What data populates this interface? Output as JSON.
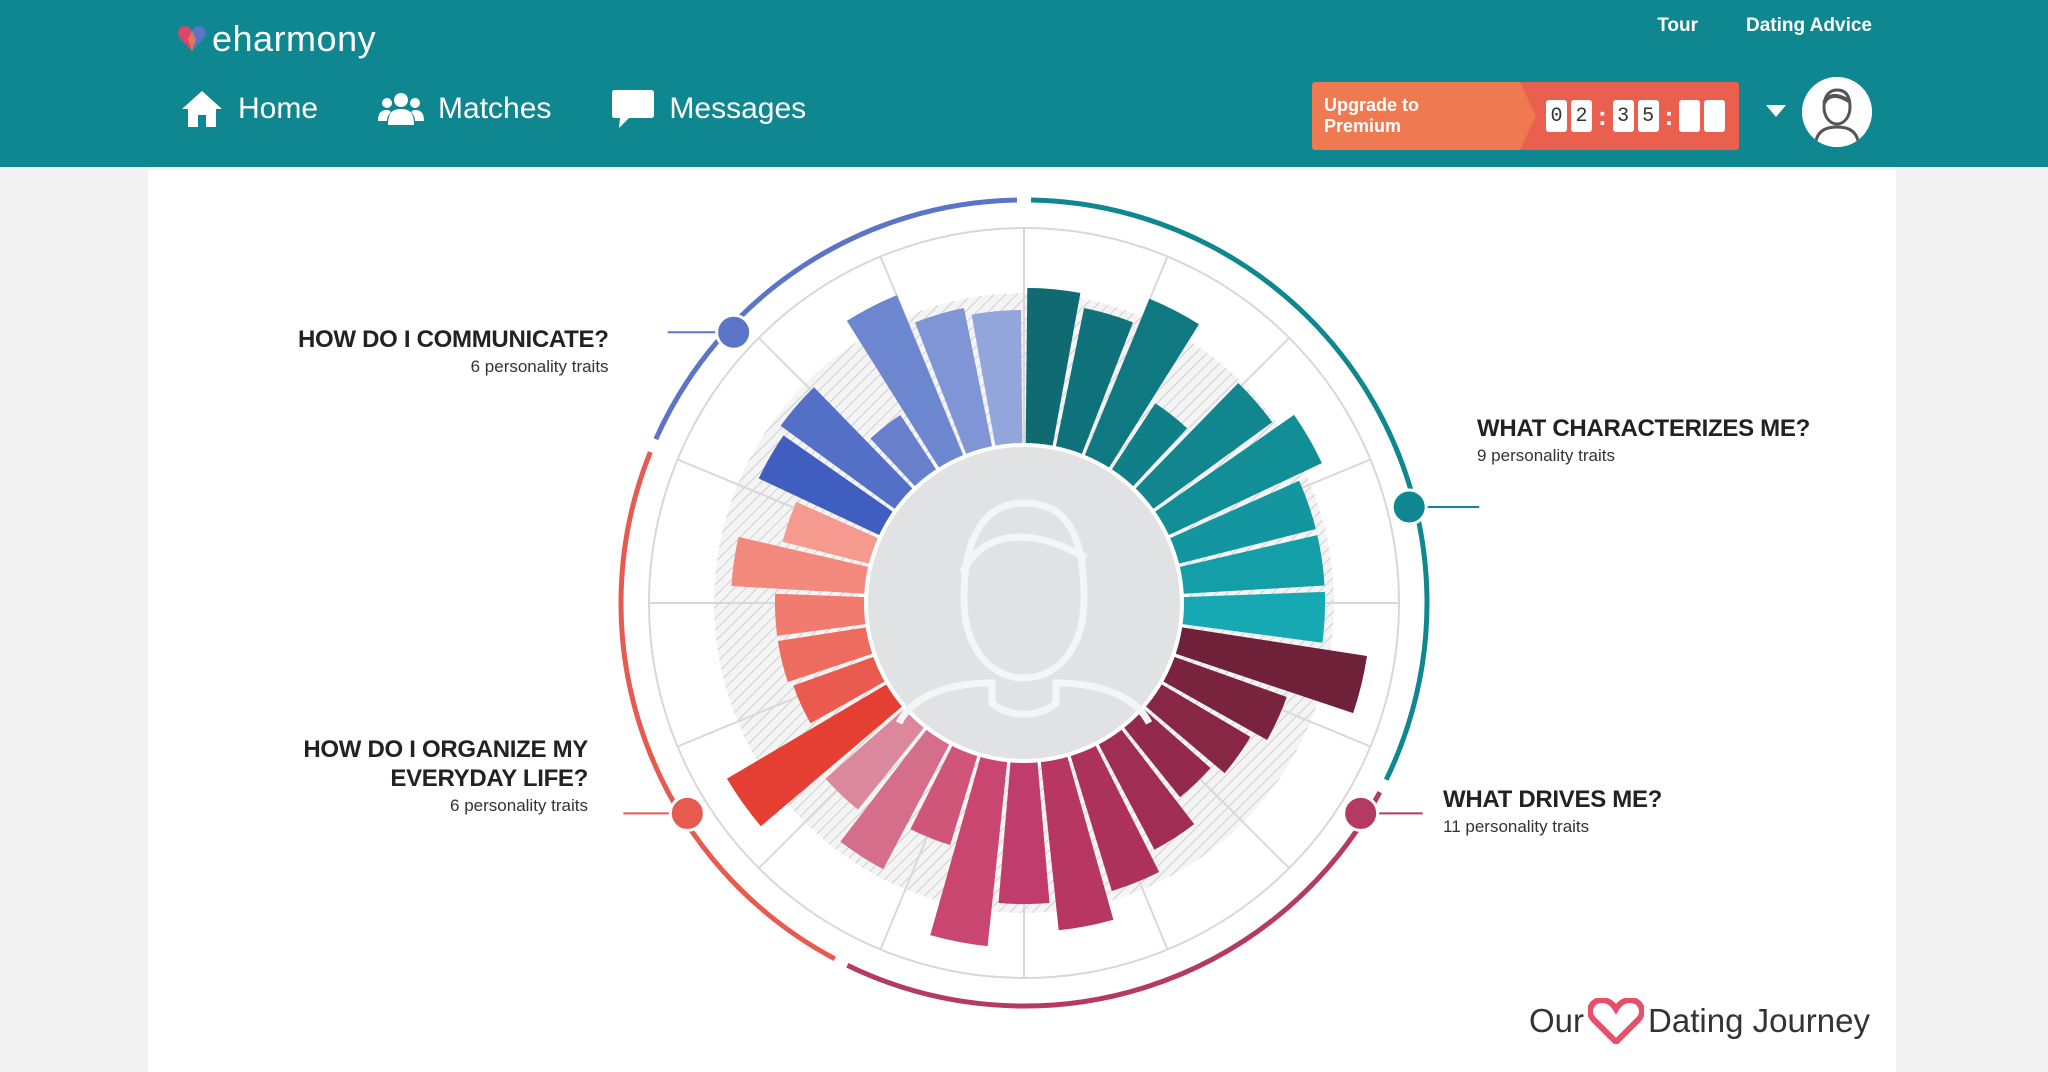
{
  "header": {
    "logo_text": "eharmony",
    "top_links": [
      "Tour",
      "Dating Advice"
    ],
    "nav": [
      {
        "label": "Home",
        "icon": "home-icon"
      },
      {
        "label": "Matches",
        "icon": "people-icon"
      },
      {
        "label": "Messages",
        "icon": "chat-bubble-icon"
      }
    ],
    "upgrade_label": "Upgrade to Premium",
    "timer_digits": [
      "0",
      "2",
      "3",
      "5",
      "",
      ""
    ],
    "colors": {
      "header_bg": "#0e8790",
      "upgrade": "#ef7a52",
      "timer": "#e9604f"
    }
  },
  "categories": [
    {
      "key": "communicate",
      "title_lines": [
        "HOW DO I COMMUNICATE?"
      ],
      "subtitle": "6 personality traits",
      "color": "#5b74c8"
    },
    {
      "key": "characterizes",
      "title_lines": [
        "WHAT CHARACTERIZES ME?"
      ],
      "subtitle": "9 personality traits",
      "color": "#0e8790"
    },
    {
      "key": "drives",
      "title_lines": [
        "WHAT DRIVES ME?"
      ],
      "subtitle": "11 personality traits",
      "color": "#b43a64"
    },
    {
      "key": "organize",
      "title_lines": [
        "HOW DO I ORGANIZE MY",
        "EVERYDAY LIFE?"
      ],
      "subtitle": "6 personality traits",
      "color": "#e75a4f"
    }
  ],
  "traits": [
    {
      "value": 0.8,
      "color": "#0f6a72"
    },
    {
      "value": 0.73,
      "color": "#0f7179"
    },
    {
      "value": 0.87,
      "color": "#107880"
    },
    {
      "value": 0.42,
      "color": "#107f87"
    },
    {
      "value": 0.76,
      "color": "#11868f"
    },
    {
      "value": 0.87,
      "color": "#128e97"
    },
    {
      "value": 0.73,
      "color": "#13969f"
    },
    {
      "value": 0.73,
      "color": "#149fa8"
    },
    {
      "value": 0.73,
      "color": "#16a9b3"
    },
    {
      "value": 0.96,
      "color": "#6e2138"
    },
    {
      "value": 0.62,
      "color": "#7a233f"
    },
    {
      "value": 0.54,
      "color": "#872645"
    },
    {
      "value": 0.47,
      "color": "#93294c"
    },
    {
      "value": 0.62,
      "color": "#a02d54"
    },
    {
      "value": 0.73,
      "color": "#ac315b"
    },
    {
      "value": 0.87,
      "color": "#b83662"
    },
    {
      "value": 0.73,
      "color": "#c03c6a"
    },
    {
      "value": 0.95,
      "color": "#c8466f"
    },
    {
      "value": 0.49,
      "color": "#cf5579"
    },
    {
      "value": 0.73,
      "color": "#d56e8a"
    },
    {
      "value": 0.55,
      "color": "#dc889c"
    },
    {
      "value": 0.95,
      "color": "#e53f33"
    },
    {
      "value": 0.45,
      "color": "#ea5a4e"
    },
    {
      "value": 0.47,
      "color": "#ed6c5f"
    },
    {
      "value": 0.47,
      "color": "#f07b6e"
    },
    {
      "value": 0.69,
      "color": "#f3897c"
    },
    {
      "value": 0.47,
      "color": "#f69a8f"
    },
    {
      "value": 0.69,
      "color": "#3f5ec0"
    },
    {
      "value": 0.73,
      "color": "#5470c6"
    },
    {
      "value": 0.35,
      "color": "#6880cc"
    },
    {
      "value": 0.89,
      "color": "#6c87d0"
    },
    {
      "value": 0.73,
      "color": "#7f95d6"
    },
    {
      "value": 0.69,
      "color": "#93a6dc"
    }
  ],
  "watermark": {
    "left": "Our",
    "right": "Dating Journey"
  }
}
